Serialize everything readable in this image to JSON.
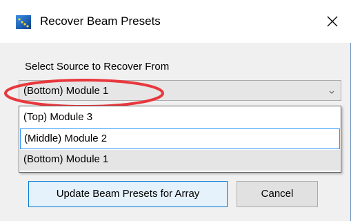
{
  "window": {
    "title": "Recover Beam Presets",
    "icon": "app-icon",
    "close_icon": "close-icon"
  },
  "form": {
    "source_label": "Select Source to Recover From",
    "combo": {
      "selected_value": "(Bottom) Module 1",
      "arrow_icon": "chevron-down-icon"
    },
    "options": [
      {
        "label": "(Top) Module 3",
        "state": "normal"
      },
      {
        "label": "(Middle) Module 2",
        "state": "hovered"
      },
      {
        "label": "(Bottom) Module 1",
        "state": "selected"
      }
    ],
    "highlight_color": "#e8383d"
  },
  "buttons": {
    "update_label": "Update Beam Presets for Array",
    "cancel_label": "Cancel"
  },
  "colors": {
    "accent": "#0078d7",
    "hover_border": "#3399ff",
    "dialog_bg": "#f0f0f0"
  }
}
